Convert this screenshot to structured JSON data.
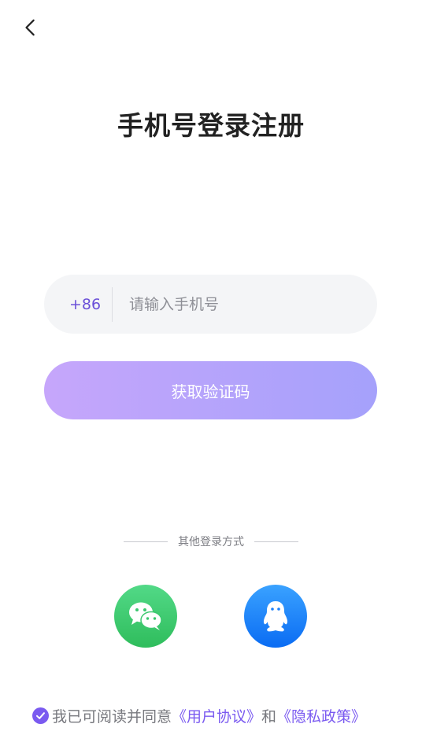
{
  "header": {
    "back_icon": "chevron-left-icon"
  },
  "title": "手机号登录注册",
  "phone": {
    "country_code": "+86",
    "placeholder": "请输入手机号",
    "value": ""
  },
  "get_code_button": "获取验证码",
  "other_login": {
    "label": "其他登录方式",
    "methods": [
      {
        "name": "wechat",
        "icon": "wechat-icon",
        "color": "#3cc86f"
      },
      {
        "name": "qq",
        "icon": "qq-icon",
        "color": "#1a80fb"
      }
    ]
  },
  "agreement": {
    "checked": true,
    "prefix": "我已可阅读并同意",
    "user_agreement": "《用户协议》",
    "conjunction": "和",
    "privacy_policy": "《隐私政策》"
  },
  "colors": {
    "accent": "#7a5af0",
    "button_gradient_start": "#c6a6fb",
    "button_gradient_end": "#a5a1fb",
    "input_bg": "#f4f5f7"
  }
}
